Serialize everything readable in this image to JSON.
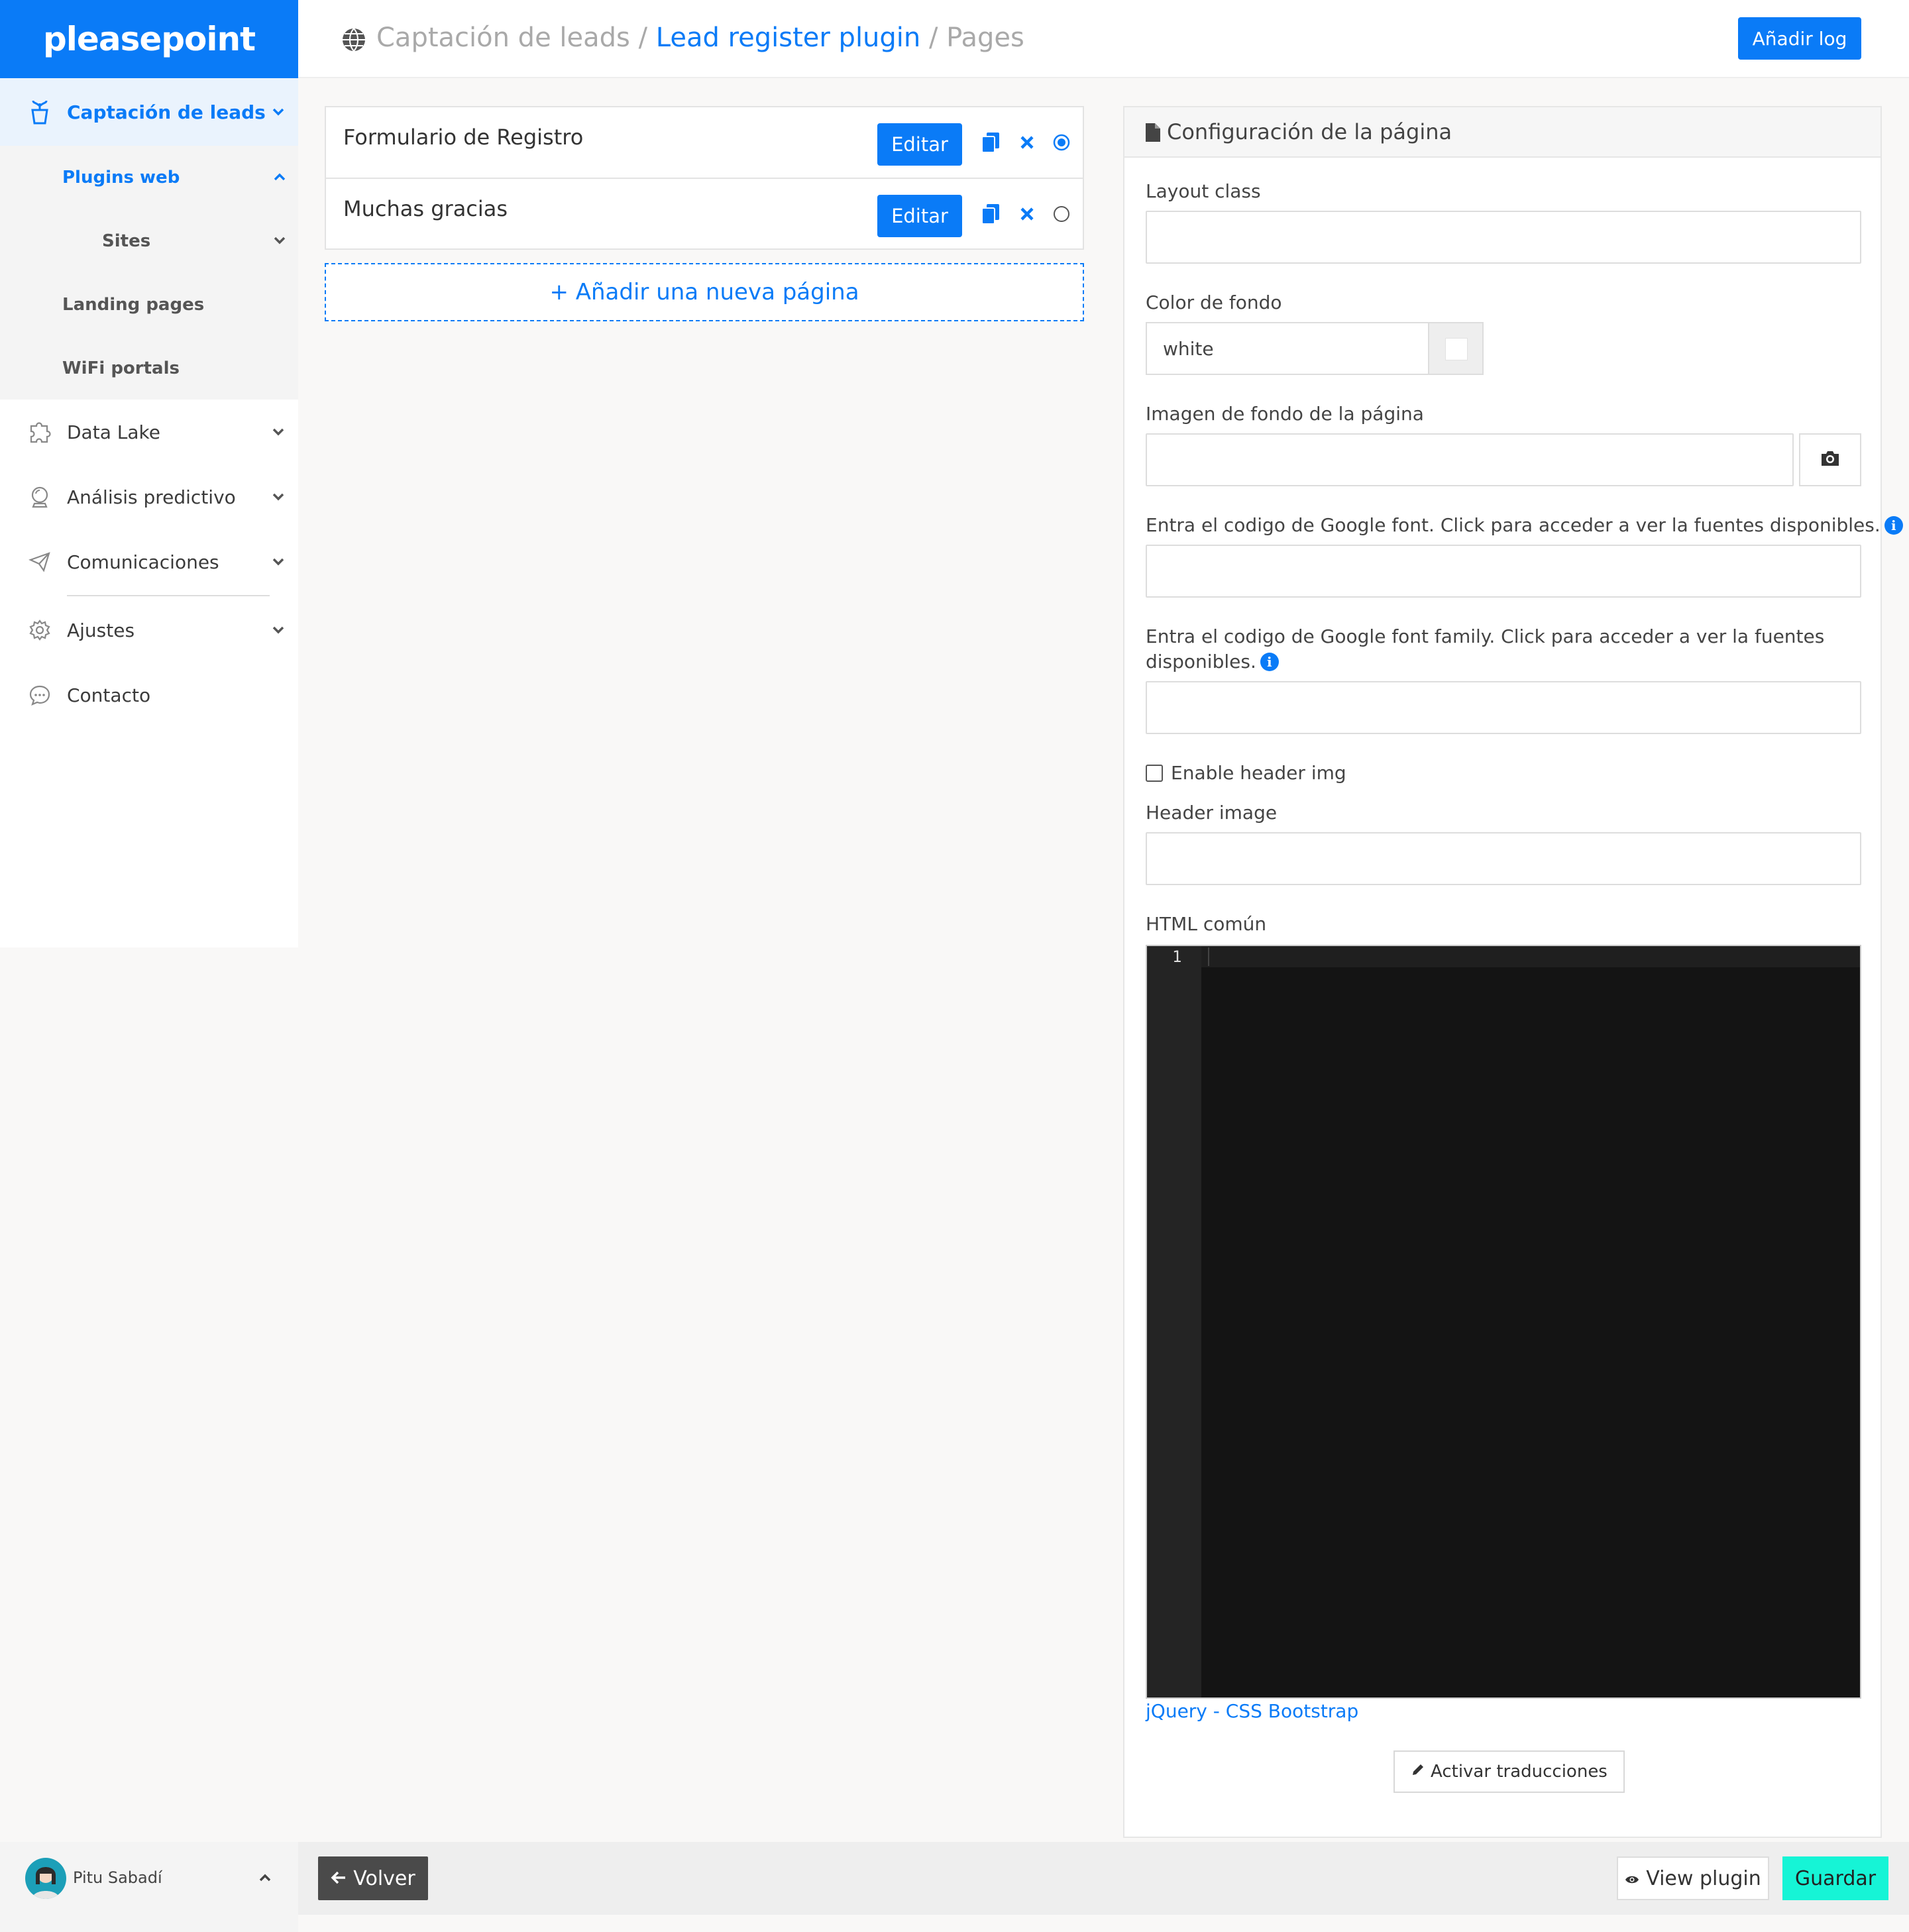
{
  "brand": {
    "logo_text": "pleasepoint",
    "accent": "#0a7bf7",
    "save_color": "#16f4d6"
  },
  "sidebar": {
    "items": [
      {
        "label": "Captación de leads",
        "icon": "plant-icon",
        "active": true
      },
      {
        "label": "Data Lake",
        "icon": "puzzle-icon"
      },
      {
        "label": "Análisis predictivo",
        "icon": "crystal-ball-icon"
      },
      {
        "label": "Comunicaciones",
        "icon": "paper-plane-icon"
      },
      {
        "label": "Ajustes",
        "icon": "gear-icon"
      },
      {
        "label": "Contacto",
        "icon": "chat-icon"
      }
    ],
    "subitems": {
      "plugins_web": "Plugins web",
      "sites": "Sites",
      "landing_pages": "Landing pages",
      "wifi_portals": "WiFi portals"
    },
    "user": {
      "name": "Pitu Sabadí"
    }
  },
  "header": {
    "breadcrumb": {
      "root": "Captación de leads",
      "sep1": " / ",
      "link": "Lead register plugin",
      "sep2": " / ",
      "current": "Pages"
    },
    "add_log_label": "Añadir log"
  },
  "pages": {
    "rows": [
      {
        "title": "Formulario de Registro",
        "edit_label": "Editar",
        "selected": true
      },
      {
        "title": "Muchas gracias",
        "edit_label": "Editar",
        "selected": false
      }
    ],
    "add_label": "+ Añadir una nueva página"
  },
  "config": {
    "title": "Configuración de la página",
    "layout_class_label": "Layout class",
    "layout_class_value": "",
    "bg_color_label": "Color de fondo",
    "bg_color_value": "white",
    "bg_image_label": "Imagen de fondo de la página",
    "google_font_label": "Entra el codigo de Google font. Click para acceder a ver la fuentes disponibles.",
    "google_font_family_label_1": "Entra el codigo de Google font family. Click para acceder a ver la fuentes",
    "google_font_family_label_2": "disponibles.",
    "enable_header_label": "Enable header img",
    "enable_header_checked": false,
    "header_image_label": "Header image",
    "html_label": "HTML común",
    "editor_line": "1",
    "link_jquery": "jQuery",
    "link_sep": " - ",
    "link_bootstrap": "CSS Bootstrap",
    "translate_label": "Activar traducciones",
    "info_glyph": "i"
  },
  "footer": {
    "back_label": "Volver",
    "view_label": "View plugin",
    "save_label": "Guardar"
  }
}
